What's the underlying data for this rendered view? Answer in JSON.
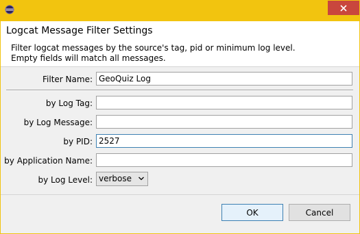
{
  "dialog": {
    "title": "Logcat Message Filter Settings",
    "description_line1": "Filter logcat messages by the source's tag, pid or minimum log level.",
    "description_line2": "Empty fields will match all messages."
  },
  "form": {
    "filter_name_label": "Filter Name:",
    "filter_name_value": "GeoQuiz Log",
    "log_tag_label": "by Log Tag:",
    "log_tag_value": "",
    "log_message_label": "by Log Message:",
    "log_message_value": "",
    "pid_label": "by PID:",
    "pid_value": "2527",
    "app_name_label": "by Application Name:",
    "app_name_value": "",
    "log_level_label": "by Log Level:",
    "log_level_value": "verbose"
  },
  "buttons": {
    "ok": "OK",
    "cancel": "Cancel"
  },
  "colors": {
    "titlebar": "#f2c40f",
    "close": "#c9463d",
    "focus_border": "#3c7fb1"
  }
}
